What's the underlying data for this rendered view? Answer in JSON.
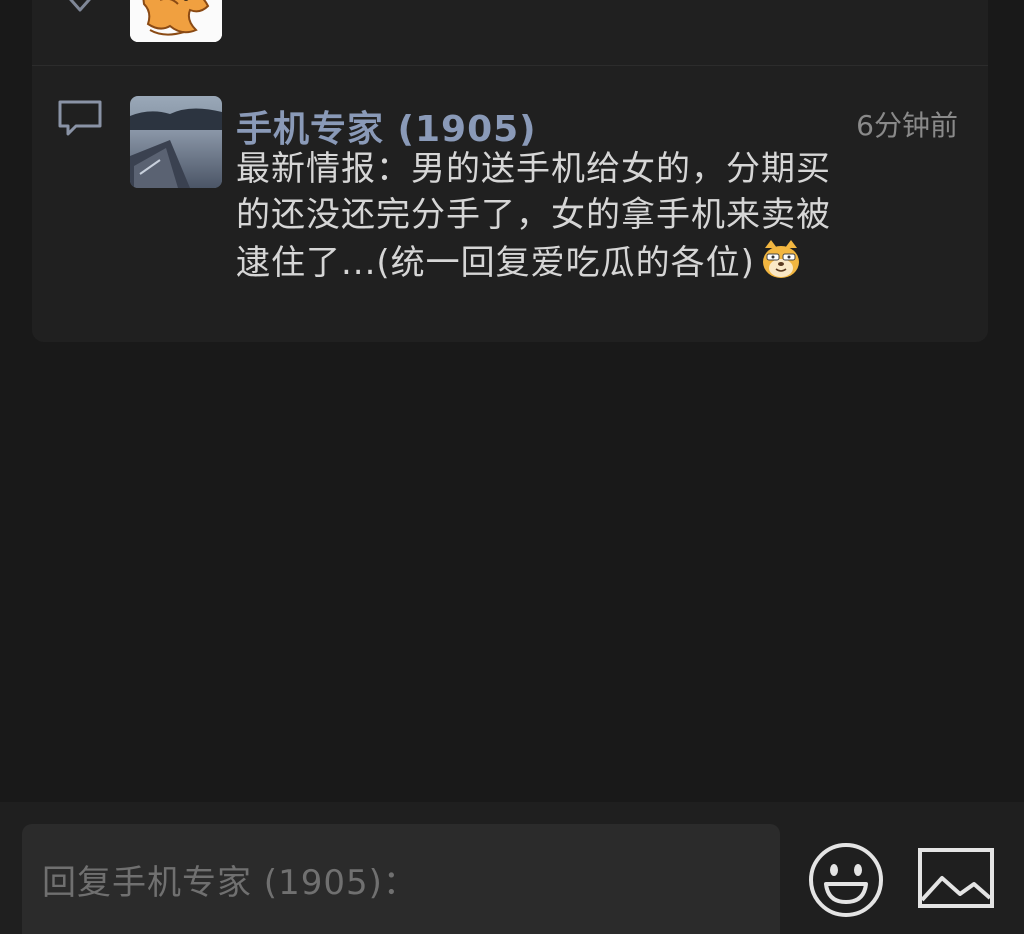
{
  "comments": [
    {
      "name": "手机专家 (1905)",
      "time": "6分钟前",
      "text_lines": [
        "最新情报：男的送手机给女的，分期买",
        "的还没还完分手了，女的拿手机来卖被",
        "逮住了...(统一回复爱吃瓜的各位)"
      ]
    }
  ],
  "reply": {
    "placeholder": "回复手机专家 (1905)："
  },
  "icons": {
    "like": "heart-outline-icon",
    "comment": "speech-bubble-icon",
    "emoji": "smiley-face-icon",
    "image": "image-picture-icon",
    "inline_emoji": "doge-emoji"
  },
  "colors": {
    "background": "#191919",
    "card": "#202020",
    "name": "#8a9ab8",
    "text": "#d6d6d6",
    "time": "#8a8a8a"
  }
}
